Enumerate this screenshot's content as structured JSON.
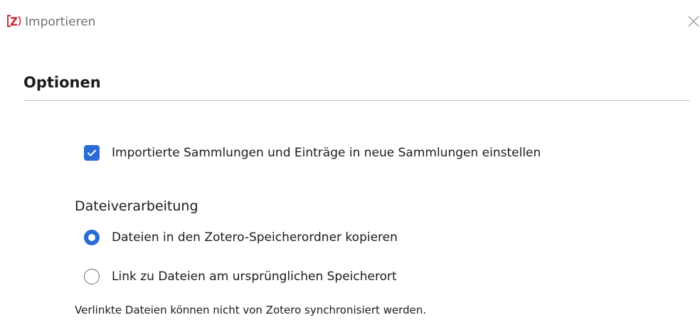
{
  "window": {
    "title": "Importieren",
    "app_icon": "zotero-logo-icon",
    "close_icon": "close-icon"
  },
  "options": {
    "title": "Optionen",
    "create_collection_checkbox": {
      "label": "Importierte Sammlungen und Einträge in neue Sammlungen einstellen",
      "checked": true
    }
  },
  "file_handling": {
    "title": "Dateiverarbeitung",
    "options": [
      {
        "label": "Dateien in den Zotero-Speicherordner kopieren",
        "selected": true
      },
      {
        "label": "Link zu Dateien am ursprünglichen Speicherort",
        "selected": false
      }
    ],
    "note": "Verlinkte Dateien können nicht von Zotero synchronisiert werden."
  },
  "colors": {
    "accent": "#2b6bd6",
    "logo_red": "#cc2936"
  }
}
